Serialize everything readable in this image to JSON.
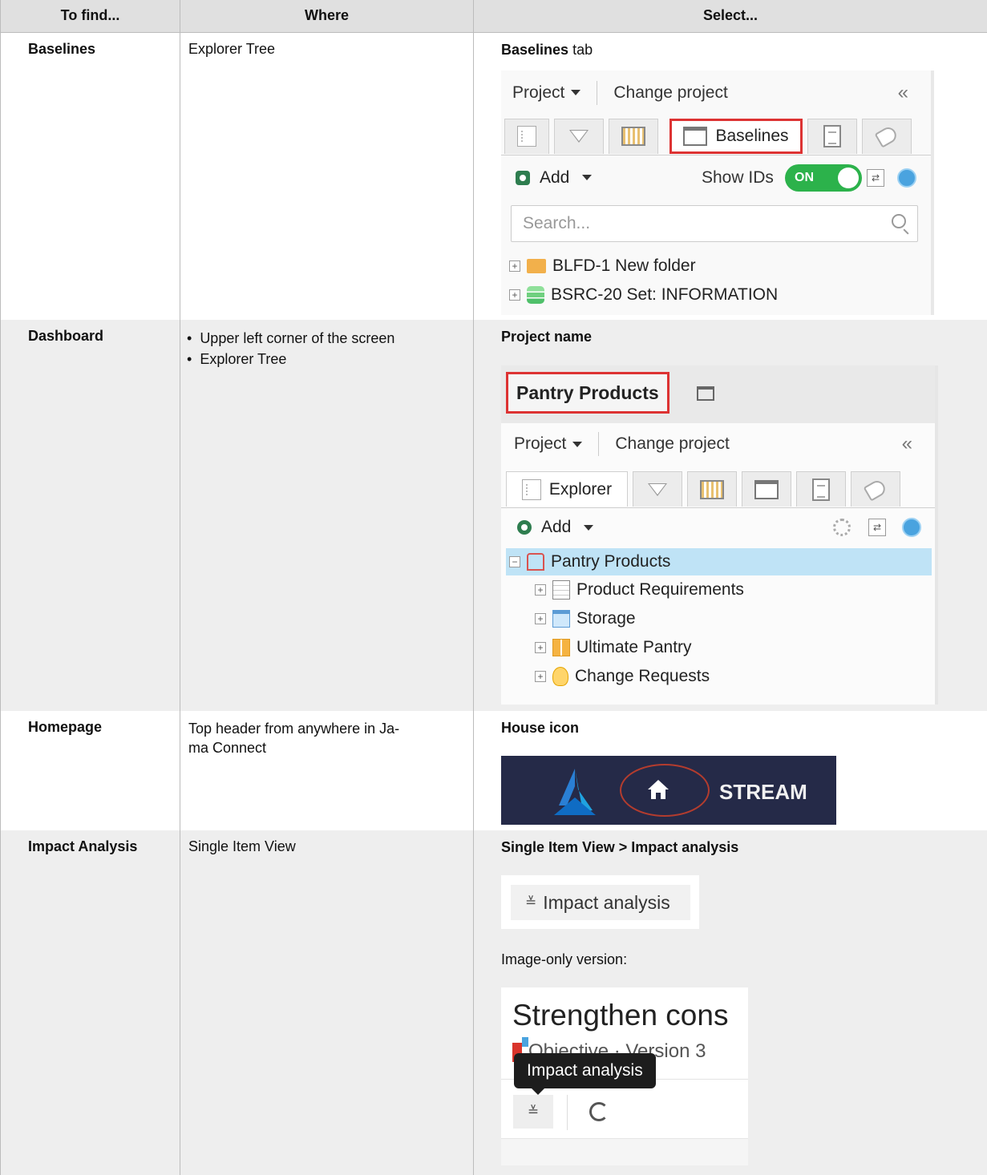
{
  "headers": {
    "find": "To find...",
    "where": "Where",
    "select": "Select..."
  },
  "rows": [
    {
      "find": "Baselines",
      "where": "Explorer Tree",
      "select_bold": "Baselines",
      "select_rest": " tab",
      "shot": {
        "project_menu": "Project",
        "change_project": "Change project",
        "collapse_icon": "double-chevron-left-icon",
        "active_tab": "Baselines",
        "add": "Add",
        "show_ids": "Show IDs",
        "toggle": "ON",
        "search_placeholder": "Search...",
        "tree": [
          "BLFD-1 New folder",
          "BSRC-20 Set: INFORMATION"
        ],
        "highlight_color": "#d33333"
      }
    },
    {
      "find": "Dashboard",
      "where_items": [
        "Upper left corner of the screen",
        "Explorer Tree"
      ],
      "select_bold": "Project name",
      "shot": {
        "project_name": "Pantry Products",
        "project_menu": "Project",
        "change_project": "Change project",
        "active_tab": "Explorer",
        "add": "Add",
        "tree_root": "Pantry Products",
        "tree": [
          "Product Requirements",
          "Storage",
          "Ultimate Pantry",
          "Change Requests"
        ],
        "selected_row_color": "#bfe3f6"
      }
    },
    {
      "find": "Homepage",
      "where": "Top header from anywhere in Ja-\nma Connect",
      "where_line1": "Top header from anywhere in Ja-",
      "where_line2": "ma Connect",
      "select_bold": "House icon",
      "shot": {
        "nav_label": "STREAM",
        "header_bg": "#252a48",
        "icon": "house-icon"
      }
    },
    {
      "find": "Impact Analysis",
      "where": "Single Item View",
      "select_bold": "Single Item View > Impact analysis",
      "shot": {
        "button_label": "Impact analysis",
        "caption": "Image-only version:",
        "title_fragment": "Strengthen cons",
        "subtitle_fragment": "Objective · Version 3",
        "tooltip": "Impact analysis"
      }
    }
  ]
}
